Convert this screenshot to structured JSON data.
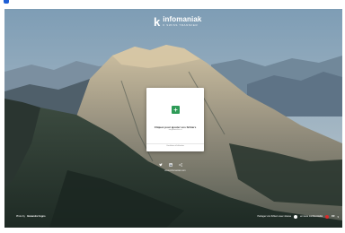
{
  "brand": {
    "name": "infomaniak",
    "tagline": "k swiss transfer"
  },
  "upload_card": {
    "title": "Cliquez pour ajouter vos fichiers",
    "subtitle": "ou glissez-les ici",
    "footer": "Conditions d'utilisation"
  },
  "social": {
    "icons": [
      "twitter-icon",
      "linkedin-icon",
      "share-icon"
    ]
  },
  "site_link": "www.infomaniak.com",
  "photo_credit": {
    "prefix": "Photo by",
    "author": "Alexandre Cogno"
  },
  "footer": {
    "secure_text": "Partagez vos fichiers avec vitesse",
    "privacy_text": "en toute confidentialité",
    "language": "FR"
  },
  "colors": {
    "accent_green": "#2e9b57",
    "brand_blue": "#1f5fd6",
    "language_dot": "#d92b2b"
  }
}
